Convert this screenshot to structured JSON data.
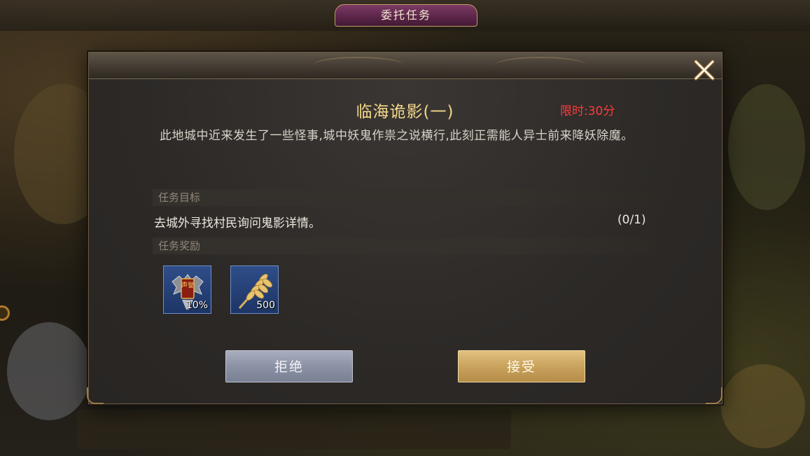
{
  "dialog": {
    "title": "委托任务",
    "close_icon": "close-x-icon"
  },
  "quest": {
    "name": "临海诡影(一)",
    "time_limit": "限时:30分",
    "description": "此地城中近来发生了一些怪事,城中妖鬼作祟之说横行,此刻正需能人异士前来降妖除魔。"
  },
  "objective": {
    "header": "任务目标",
    "text": "去城外寻找村民询问鬼影详情。",
    "progress": "(0/1)"
  },
  "rewards": {
    "header": "任务奖励",
    "items": [
      {
        "icon": "reputation-badge-icon",
        "badge_text": "声誉",
        "quantity": "10%"
      },
      {
        "icon": "wheat-grain-icon",
        "quantity": "500"
      }
    ]
  },
  "buttons": {
    "reject": "拒绝",
    "accept": "接受"
  },
  "colors": {
    "title_gold": "#f4d88a",
    "time_red": "#ff3a3a",
    "accept_gold": "#c9a35e",
    "reject_gray": "#8c92a5",
    "title_badge_purple": "#5a2448"
  }
}
